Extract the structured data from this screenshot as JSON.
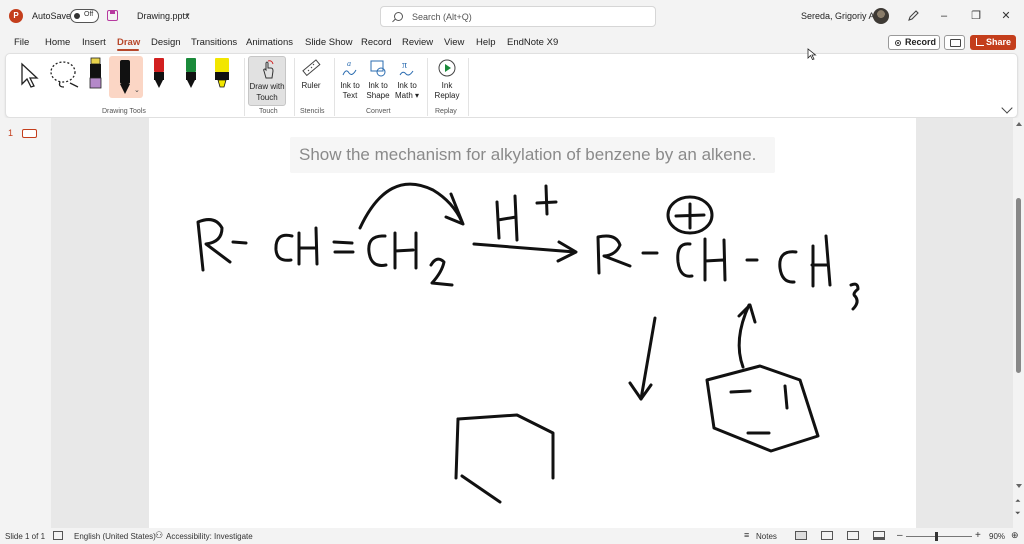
{
  "titlebar": {
    "app_icon": "P",
    "autosave_label": "AutoSave",
    "autosave_state": "Off",
    "filename": "Drawing.pptx",
    "filename_caret": "▾",
    "search_placeholder": "Search (Alt+Q)",
    "username": "Sereda, Grigoriy A",
    "minimize": "–",
    "restore": "❐",
    "close": "✕"
  },
  "tabs": [
    "File",
    "Home",
    "Insert",
    "Draw",
    "Design",
    "Transitions",
    "Animations",
    "Slide Show",
    "Record",
    "Review",
    "View",
    "Help",
    "EndNote X9"
  ],
  "active_tab": "Draw",
  "actions": {
    "record": "Record",
    "share": "Share"
  },
  "ribbon": {
    "groups": {
      "drawing_tools": "Drawing Tools",
      "touch": "Touch",
      "stencils": "Stencils",
      "convert": "Convert",
      "replay": "Replay"
    },
    "buttons": {
      "draw_with_touch_1": "Draw with",
      "draw_with_touch_2": "Touch",
      "ruler": "Ruler",
      "ink_to_text_1": "Ink to",
      "ink_to_text_2": "Text",
      "ink_to_shape_1": "Ink to",
      "ink_to_shape_2": "Shape",
      "ink_to_math_1": "Ink to",
      "ink_to_math_2": "Math ▾",
      "ink_replay_1": "Ink",
      "ink_replay_2": "Replay"
    },
    "pen_colors": [
      "#e8d24a",
      "#111111",
      "#d22020",
      "#1a8a3a",
      "#f2e600"
    ]
  },
  "slide_panel": {
    "slide_number": "1"
  },
  "slide": {
    "title": "Show the mechanism for alkylation of benzene by an alkene."
  },
  "statusbar": {
    "slide_count": "Slide 1 of 1",
    "language": "English (United States)",
    "accessibility": "Accessibility: Investigate",
    "notes": "Notes",
    "zoom_minus": "–",
    "zoom_plus": "+",
    "zoom": "90%"
  }
}
